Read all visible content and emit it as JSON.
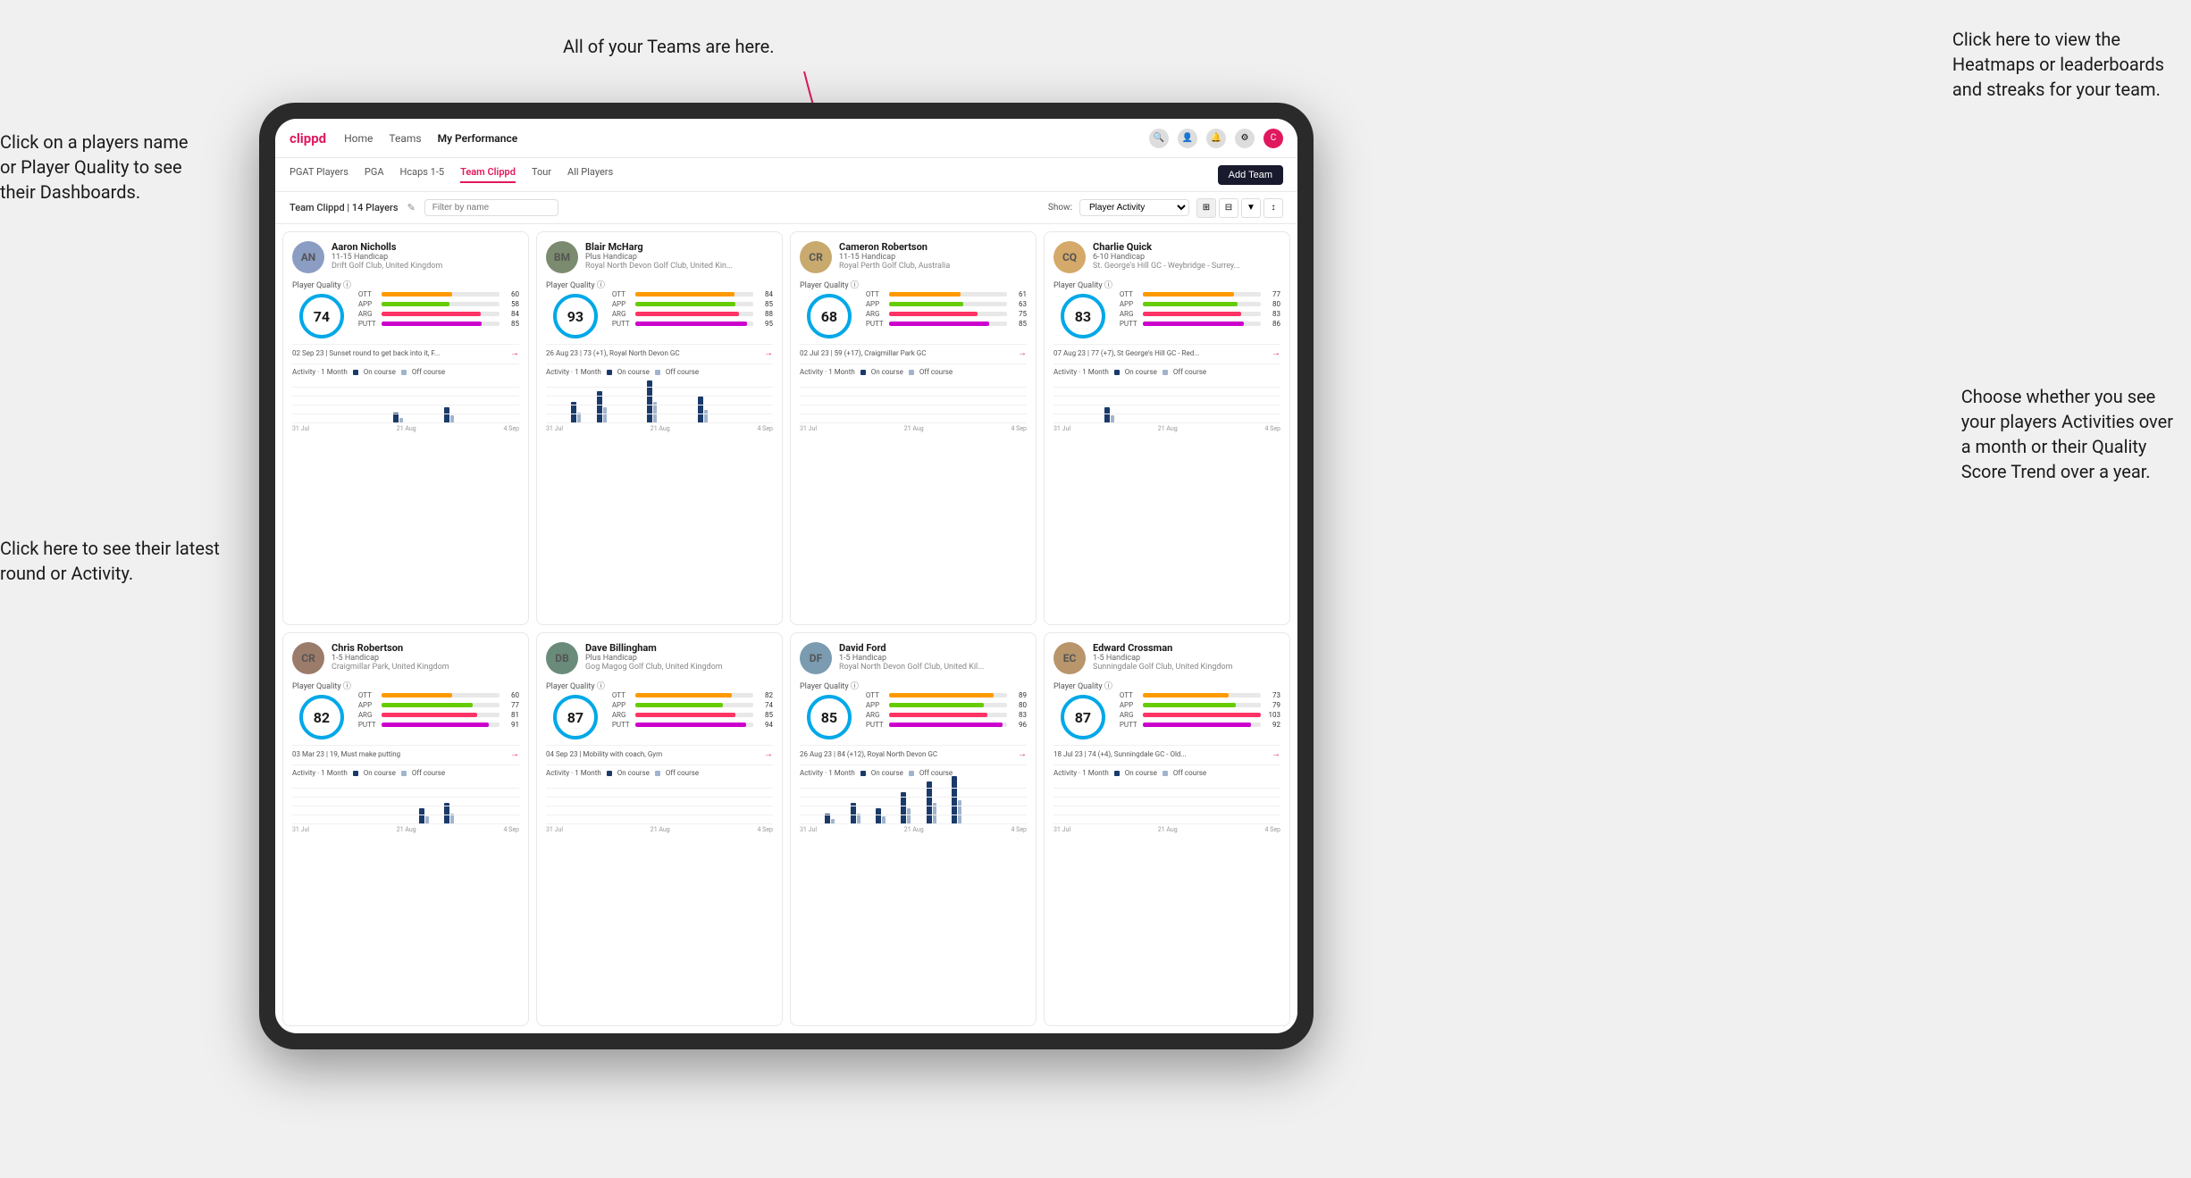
{
  "annotations": {
    "top_center": "All of your Teams are here.",
    "top_right_title": "Click here to view the",
    "top_right_line2": "Heatmaps or leaderboards",
    "top_right_line3": "and streaks for your team.",
    "left_top_title": "Click on a players name",
    "left_top_line2": "or Player Quality to see",
    "left_top_line3": "their Dashboards.",
    "left_bottom_title": "Click here to see their latest",
    "left_bottom_line2": "round or Activity.",
    "right_bottom_title": "Choose whether you see",
    "right_bottom_line2": "your players Activities over",
    "right_bottom_line3": "a month or their Quality",
    "right_bottom_line4": "Score Trend over a year."
  },
  "nav": {
    "logo": "clippd",
    "links": [
      "Home",
      "Teams",
      "My Performance"
    ],
    "icons": [
      "search",
      "user",
      "bell",
      "settings",
      "avatar"
    ]
  },
  "tabs": {
    "items": [
      "PGAT Players",
      "PGA",
      "Hcaps 1-5",
      "Team Clippd",
      "Tour",
      "All Players"
    ],
    "active": "Team Clippd",
    "add_button": "Add Team"
  },
  "filter": {
    "label": "Team Clippd | 14 Players",
    "edit_icon": "✎",
    "search_placeholder": "Filter by name",
    "show_label": "Show:",
    "show_option": "Player Activity",
    "view_icons": [
      "grid4",
      "grid3",
      "filter",
      "sort"
    ]
  },
  "players": [
    {
      "name": "Aaron Nicholls",
      "handicap": "11-15 Handicap",
      "club": "Drift Golf Club, United Kingdom",
      "quality": 74,
      "ott": 60,
      "app": 58,
      "arg": 84,
      "putt": 85,
      "latest_round": "02 Sep 23 | Sunset round to get back into it, F...",
      "avatar_color": "#8B9DC3",
      "avatar_initials": "AN",
      "bars": [
        {
          "label": "OTT",
          "value": 60,
          "type": "ott"
        },
        {
          "label": "APP",
          "value": 58,
          "type": "app"
        },
        {
          "label": "ARG",
          "value": 84,
          "type": "arg"
        },
        {
          "label": "PUTT",
          "value": 85,
          "type": "putt"
        }
      ],
      "chart_bars": [
        0,
        0,
        0,
        0,
        2,
        0,
        3,
        0,
        0
      ]
    },
    {
      "name": "Blair McHarg",
      "handicap": "Plus Handicap",
      "club": "Royal North Devon Golf Club, United Kin...",
      "quality": 93,
      "ott": 84,
      "app": 85,
      "arg": 88,
      "putt": 95,
      "latest_round": "26 Aug 23 | 73 (+1), Royal North Devon GC",
      "avatar_color": "#7B8B6F",
      "avatar_initials": "BM",
      "bars": [
        {
          "label": "OTT",
          "value": 84,
          "type": "ott"
        },
        {
          "label": "APP",
          "value": 85,
          "type": "app"
        },
        {
          "label": "ARG",
          "value": 88,
          "type": "arg"
        },
        {
          "label": "PUTT",
          "value": 95,
          "type": "putt"
        }
      ],
      "chart_bars": [
        0,
        4,
        6,
        0,
        8,
        0,
        5,
        0,
        0
      ]
    },
    {
      "name": "Cameron Robertson",
      "handicap": "11-15 Handicap",
      "club": "Royal Perth Golf Club, Australia",
      "quality": 68,
      "ott": 61,
      "app": 63,
      "arg": 75,
      "putt": 85,
      "latest_round": "02 Jul 23 | 59 (+17), Craigmillar Park GC",
      "avatar_color": "#C8A96E",
      "avatar_initials": "CR",
      "bars": [
        {
          "label": "OTT",
          "value": 61,
          "type": "ott"
        },
        {
          "label": "APP",
          "value": 63,
          "type": "app"
        },
        {
          "label": "ARG",
          "value": 75,
          "type": "arg"
        },
        {
          "label": "PUTT",
          "value": 85,
          "type": "putt"
        }
      ],
      "chart_bars": [
        0,
        0,
        0,
        0,
        0,
        0,
        0,
        0,
        0
      ]
    },
    {
      "name": "Charlie Quick",
      "handicap": "6-10 Handicap",
      "club": "St. George's Hill GC - Weybridge - Surrey...",
      "quality": 83,
      "ott": 77,
      "app": 80,
      "arg": 83,
      "putt": 86,
      "latest_round": "07 Aug 23 | 77 (+7), St George's Hill GC - Red...",
      "avatar_color": "#D4A96A",
      "avatar_initials": "CQ",
      "bars": [
        {
          "label": "OTT",
          "value": 77,
          "type": "ott"
        },
        {
          "label": "APP",
          "value": 80,
          "type": "app"
        },
        {
          "label": "ARG",
          "value": 83,
          "type": "arg"
        },
        {
          "label": "PUTT",
          "value": 86,
          "type": "putt"
        }
      ],
      "chart_bars": [
        0,
        0,
        3,
        0,
        0,
        0,
        0,
        0,
        0
      ]
    },
    {
      "name": "Chris Robertson",
      "handicap": "1-5 Handicap",
      "club": "Craigmillar Park, United Kingdom",
      "quality": 82,
      "ott": 60,
      "app": 77,
      "arg": 81,
      "putt": 91,
      "latest_round": "03 Mar 23 | 19, Must make putting",
      "avatar_color": "#9B7B6A",
      "avatar_initials": "CR",
      "bars": [
        {
          "label": "OTT",
          "value": 60,
          "type": "ott"
        },
        {
          "label": "APP",
          "value": 77,
          "type": "app"
        },
        {
          "label": "ARG",
          "value": 81,
          "type": "arg"
        },
        {
          "label": "PUTT",
          "value": 91,
          "type": "putt"
        }
      ],
      "chart_bars": [
        0,
        0,
        0,
        0,
        0,
        3,
        4,
        0,
        0
      ]
    },
    {
      "name": "Dave Billingham",
      "handicap": "Plus Handicap",
      "club": "Gog Magog Golf Club, United Kingdom",
      "quality": 87,
      "ott": 82,
      "app": 74,
      "arg": 85,
      "putt": 94,
      "latest_round": "04 Sep 23 | Mobility with coach, Gym",
      "avatar_color": "#6A8B7A",
      "avatar_initials": "DB",
      "bars": [
        {
          "label": "OTT",
          "value": 82,
          "type": "ott"
        },
        {
          "label": "APP",
          "value": 74,
          "type": "app"
        },
        {
          "label": "ARG",
          "value": 85,
          "type": "arg"
        },
        {
          "label": "PUTT",
          "value": 94,
          "type": "putt"
        }
      ],
      "chart_bars": [
        0,
        0,
        0,
        0,
        0,
        0,
        0,
        0,
        0
      ]
    },
    {
      "name": "David Ford",
      "handicap": "1-5 Handicap",
      "club": "Royal North Devon Golf Club, United Kil...",
      "quality": 85,
      "ott": 89,
      "app": 80,
      "arg": 83,
      "putt": 96,
      "latest_round": "26 Aug 23 | 84 (+12), Royal North Devon GC",
      "avatar_color": "#7A9BB0",
      "avatar_initials": "DF",
      "bars": [
        {
          "label": "OTT",
          "value": 89,
          "type": "ott"
        },
        {
          "label": "APP",
          "value": 80,
          "type": "app"
        },
        {
          "label": "ARG",
          "value": 83,
          "type": "arg"
        },
        {
          "label": "PUTT",
          "value": 96,
          "type": "putt"
        }
      ],
      "chart_bars": [
        0,
        2,
        4,
        3,
        6,
        8,
        9,
        0,
        0
      ]
    },
    {
      "name": "Edward Crossman",
      "handicap": "1-5 Handicap",
      "club": "Sunningdale Golf Club, United Kingdom",
      "quality": 87,
      "ott": 73,
      "app": 79,
      "arg": 103,
      "putt": 92,
      "latest_round": "18 Jul 23 | 74 (+4), Sunningdale GC - Old...",
      "avatar_color": "#B8956A",
      "avatar_initials": "EC",
      "bars": [
        {
          "label": "OTT",
          "value": 73,
          "type": "ott"
        },
        {
          "label": "APP",
          "value": 79,
          "type": "app"
        },
        {
          "label": "ARG",
          "value": 103,
          "type": "arg"
        },
        {
          "label": "PUTT",
          "value": 92,
          "type": "putt"
        }
      ],
      "chart_bars": [
        0,
        0,
        0,
        0,
        0,
        0,
        0,
        0,
        0
      ]
    }
  ],
  "chart": {
    "x_labels": [
      "31 Jul",
      "21 Aug",
      "4 Sep"
    ],
    "legend_on": "On course",
    "legend_off": "Off course",
    "activity_label": "Activity · 1 Month"
  }
}
